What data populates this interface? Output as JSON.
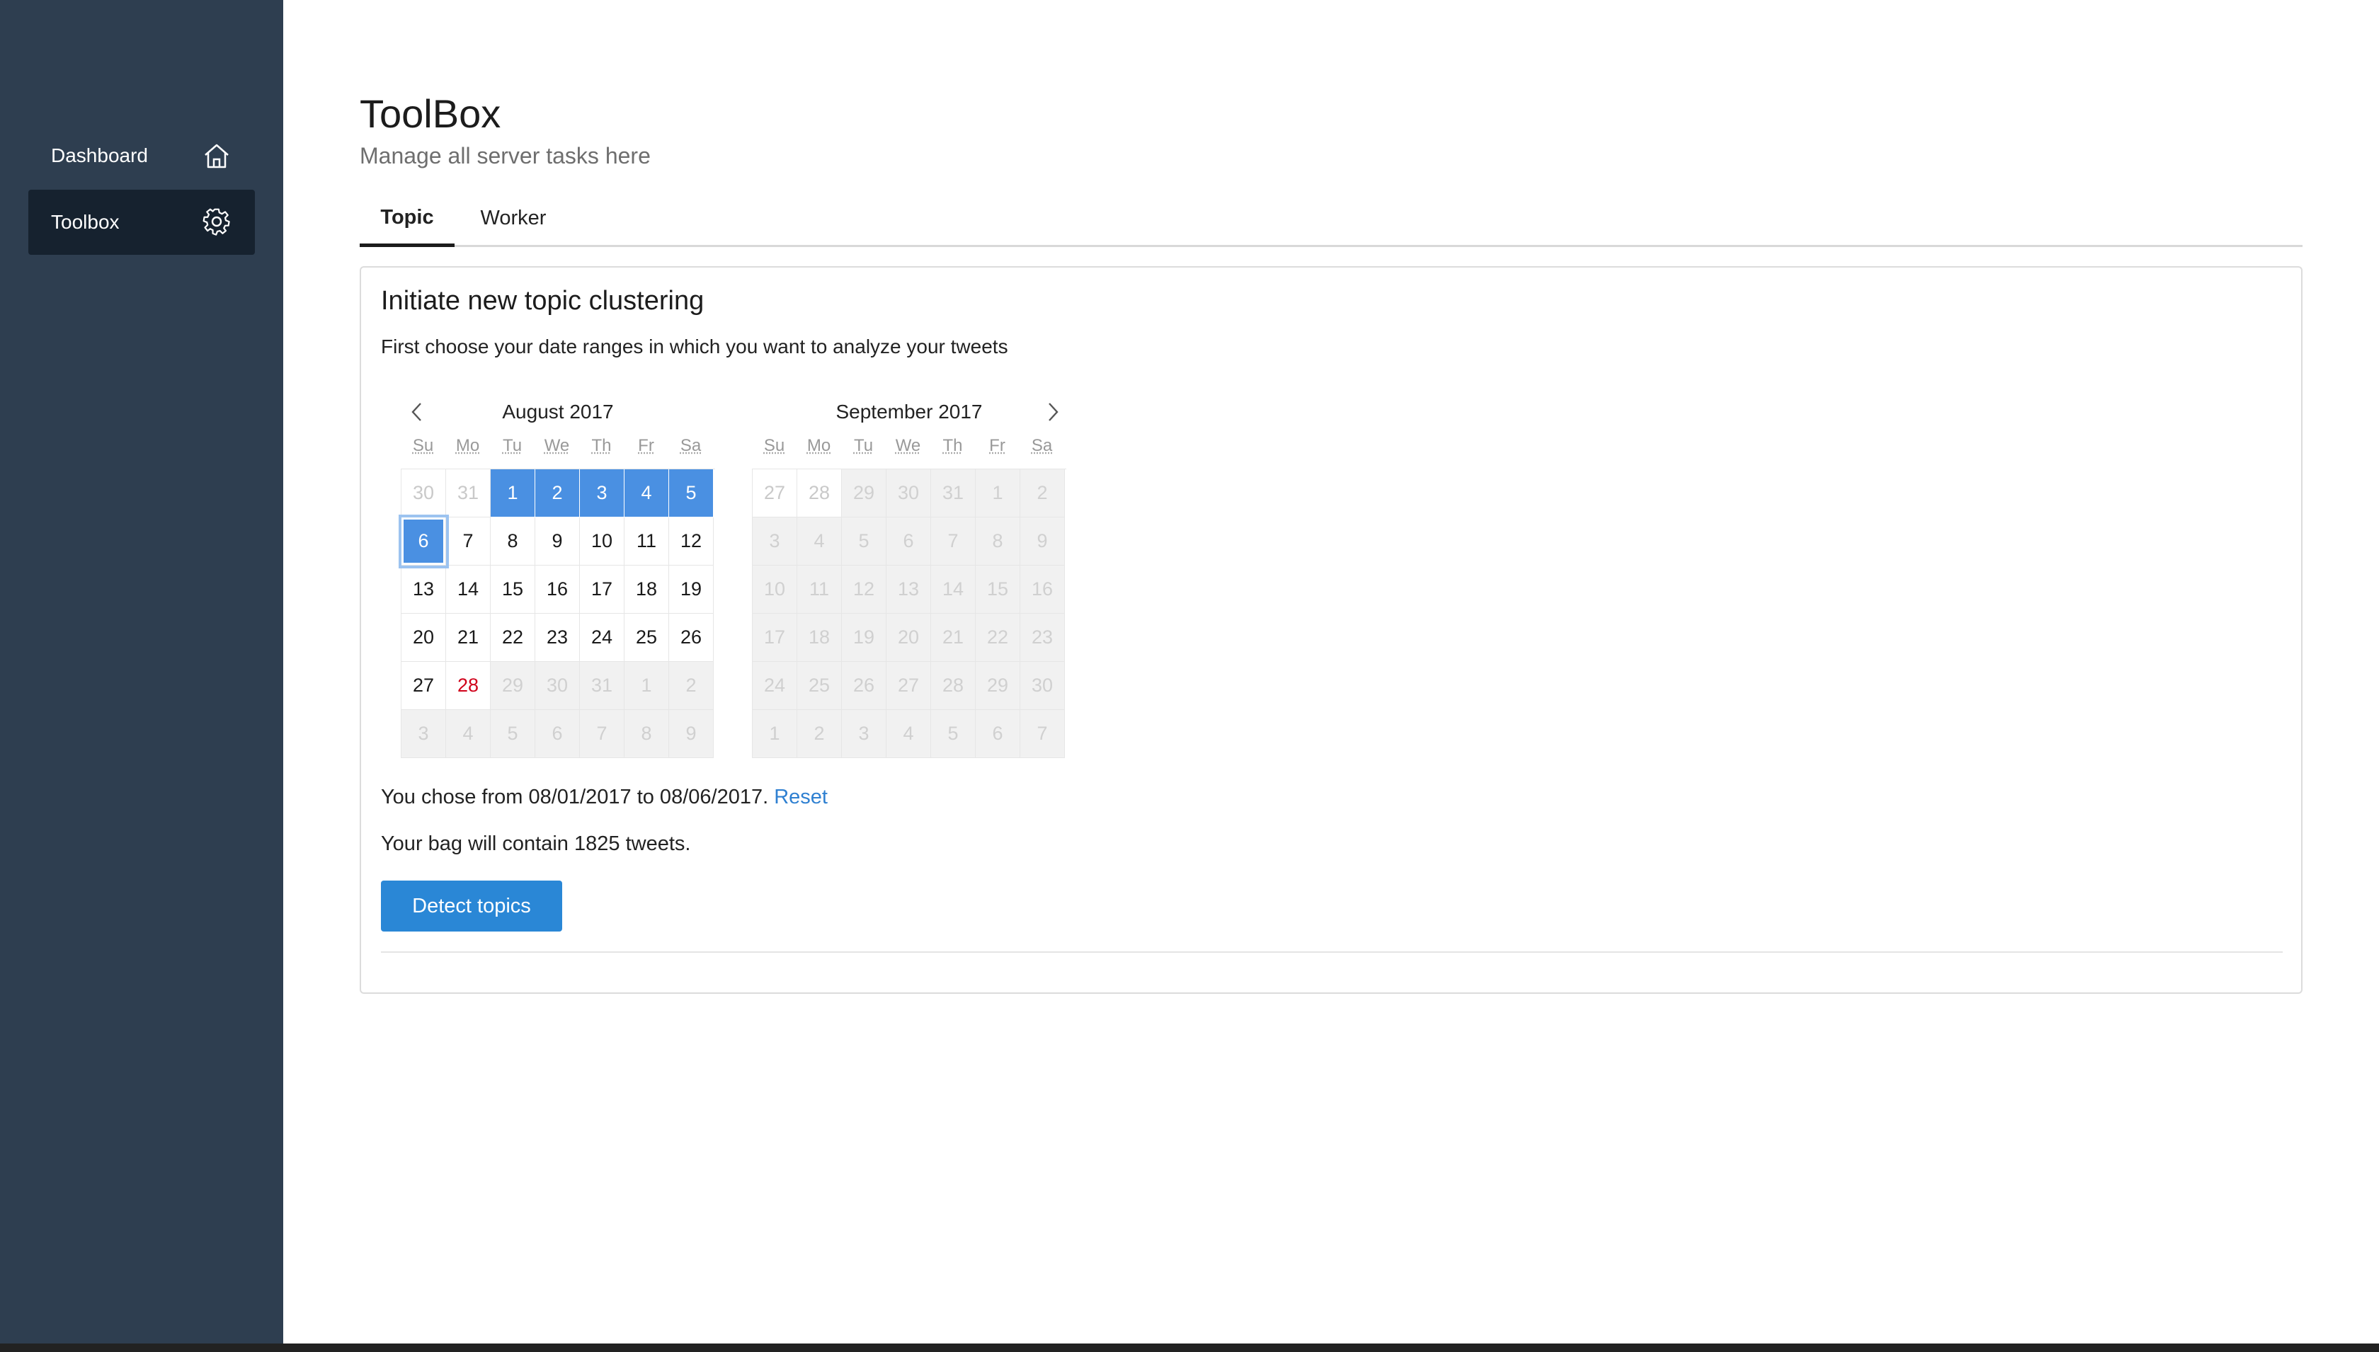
{
  "sidebar": {
    "items": [
      {
        "label": "Dashboard",
        "icon": "home-icon",
        "active": false
      },
      {
        "label": "Toolbox",
        "icon": "gear-icon",
        "active": true
      }
    ]
  },
  "header": {
    "title": "ToolBox",
    "subtitle": "Manage all server tasks here"
  },
  "tabs": [
    {
      "label": "Topic",
      "active": true
    },
    {
      "label": "Worker",
      "active": false
    }
  ],
  "panel": {
    "title": "Initiate new topic clustering",
    "description": "First choose your date ranges in which you want to analyze your tweets",
    "calendars": [
      {
        "month": "August 2017",
        "weekdays": [
          "Su",
          "Mo",
          "Tu",
          "We",
          "Th",
          "Fr",
          "Sa"
        ],
        "days": [
          {
            "d": "30",
            "s": "other"
          },
          {
            "d": "31",
            "s": "other"
          },
          {
            "d": "1",
            "s": "selected"
          },
          {
            "d": "2",
            "s": "selected"
          },
          {
            "d": "3",
            "s": "selected"
          },
          {
            "d": "4",
            "s": "selected"
          },
          {
            "d": "5",
            "s": "selected"
          },
          {
            "d": "6",
            "s": "focused"
          },
          {
            "d": "7",
            "s": ""
          },
          {
            "d": "8",
            "s": ""
          },
          {
            "d": "9",
            "s": ""
          },
          {
            "d": "10",
            "s": ""
          },
          {
            "d": "11",
            "s": ""
          },
          {
            "d": "12",
            "s": ""
          },
          {
            "d": "13",
            "s": ""
          },
          {
            "d": "14",
            "s": ""
          },
          {
            "d": "15",
            "s": ""
          },
          {
            "d": "16",
            "s": ""
          },
          {
            "d": "17",
            "s": ""
          },
          {
            "d": "18",
            "s": ""
          },
          {
            "d": "19",
            "s": ""
          },
          {
            "d": "20",
            "s": ""
          },
          {
            "d": "21",
            "s": ""
          },
          {
            "d": "22",
            "s": ""
          },
          {
            "d": "23",
            "s": ""
          },
          {
            "d": "24",
            "s": ""
          },
          {
            "d": "25",
            "s": ""
          },
          {
            "d": "26",
            "s": ""
          },
          {
            "d": "27",
            "s": ""
          },
          {
            "d": "28",
            "s": "today"
          },
          {
            "d": "29",
            "s": "disabled"
          },
          {
            "d": "30",
            "s": "disabled"
          },
          {
            "d": "31",
            "s": "disabled"
          },
          {
            "d": "1",
            "s": "disabled"
          },
          {
            "d": "2",
            "s": "disabled"
          },
          {
            "d": "3",
            "s": "disabled"
          },
          {
            "d": "4",
            "s": "disabled"
          },
          {
            "d": "5",
            "s": "disabled"
          },
          {
            "d": "6",
            "s": "disabled"
          },
          {
            "d": "7",
            "s": "disabled"
          },
          {
            "d": "8",
            "s": "disabled"
          },
          {
            "d": "9",
            "s": "disabled"
          }
        ]
      },
      {
        "month": "September 2017",
        "weekdays": [
          "Su",
          "Mo",
          "Tu",
          "We",
          "Th",
          "Fr",
          "Sa"
        ],
        "days": [
          {
            "d": "27",
            "s": "other"
          },
          {
            "d": "28",
            "s": "other"
          },
          {
            "d": "29",
            "s": "disabled"
          },
          {
            "d": "30",
            "s": "disabled"
          },
          {
            "d": "31",
            "s": "disabled"
          },
          {
            "d": "1",
            "s": "disabled"
          },
          {
            "d": "2",
            "s": "disabled"
          },
          {
            "d": "3",
            "s": "disabled"
          },
          {
            "d": "4",
            "s": "disabled"
          },
          {
            "d": "5",
            "s": "disabled"
          },
          {
            "d": "6",
            "s": "disabled"
          },
          {
            "d": "7",
            "s": "disabled"
          },
          {
            "d": "8",
            "s": "disabled"
          },
          {
            "d": "9",
            "s": "disabled"
          },
          {
            "d": "10",
            "s": "disabled"
          },
          {
            "d": "11",
            "s": "disabled"
          },
          {
            "d": "12",
            "s": "disabled"
          },
          {
            "d": "13",
            "s": "disabled"
          },
          {
            "d": "14",
            "s": "disabled"
          },
          {
            "d": "15",
            "s": "disabled"
          },
          {
            "d": "16",
            "s": "disabled"
          },
          {
            "d": "17",
            "s": "disabled"
          },
          {
            "d": "18",
            "s": "disabled"
          },
          {
            "d": "19",
            "s": "disabled"
          },
          {
            "d": "20",
            "s": "disabled"
          },
          {
            "d": "21",
            "s": "disabled"
          },
          {
            "d": "22",
            "s": "disabled"
          },
          {
            "d": "23",
            "s": "disabled"
          },
          {
            "d": "24",
            "s": "disabled"
          },
          {
            "d": "25",
            "s": "disabled"
          },
          {
            "d": "26",
            "s": "disabled"
          },
          {
            "d": "27",
            "s": "disabled"
          },
          {
            "d": "28",
            "s": "disabled"
          },
          {
            "d": "29",
            "s": "disabled"
          },
          {
            "d": "30",
            "s": "disabled"
          },
          {
            "d": "1",
            "s": "disabled"
          },
          {
            "d": "2",
            "s": "disabled"
          },
          {
            "d": "3",
            "s": "disabled"
          },
          {
            "d": "4",
            "s": "disabled"
          },
          {
            "d": "5",
            "s": "disabled"
          },
          {
            "d": "6",
            "s": "disabled"
          },
          {
            "d": "7",
            "s": "disabled"
          }
        ]
      }
    ],
    "chosen_prefix": "You chose from 08/01/2017 to 08/06/2017.",
    "reset_label": "Reset",
    "bag_text": "Your bag will contain 1825 tweets.",
    "detect_button": "Detect topics"
  },
  "colors": {
    "sidebar": "#2e3e50",
    "sidebar_active": "#16222f",
    "accent": "#4a90e2",
    "button": "#2a87d6",
    "today": "#d0021b"
  }
}
